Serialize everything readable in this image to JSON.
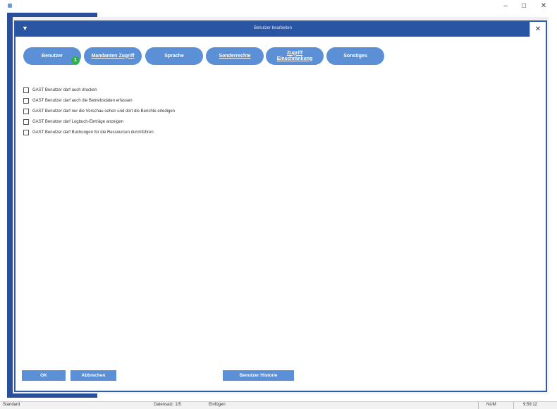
{
  "window": {
    "minimize_label": "–",
    "maximize_label": "☐",
    "close_label": "✕"
  },
  "dialog": {
    "title": "Benutzer bearbeiten",
    "close_label": "✕"
  },
  "tabs": [
    {
      "label": "Benutzer",
      "badge": "1"
    },
    {
      "label": "Mandanten Zugriff"
    },
    {
      "label": "Sprache"
    },
    {
      "label": "Sonderrechte"
    },
    {
      "label": "Zugriff Einschränkung"
    },
    {
      "label": "Sonstiges"
    }
  ],
  "options": [
    {
      "label": "GAST Benutzer darf auch drucken",
      "checked": false
    },
    {
      "label": "GAST Benutzer darf auch die Betriebsdaten erfassen",
      "checked": false
    },
    {
      "label": "GAST Benutzer darf nur die Vorschau sehen und dort die Berichte erledigen",
      "checked": false
    },
    {
      "label": "GAST Benutzer darf Logbuch-Einträge anzeigen",
      "checked": false
    },
    {
      "label": "GAST Benutzer darf Buchungen für die Ressourcen durchführen",
      "checked": false
    }
  ],
  "buttons": {
    "ok": "OK",
    "cancel": "Abbrechen",
    "history": "Benutzer Historie"
  },
  "statusbar": {
    "mode": "Standard",
    "record": "Datensatz: 1/5",
    "state": "Einfügen",
    "num": "NUM",
    "time": "9:59:12"
  },
  "colors": {
    "titlebar": "#2a55a3",
    "tab": "#5b8fd6",
    "badge": "#2bb24c"
  }
}
